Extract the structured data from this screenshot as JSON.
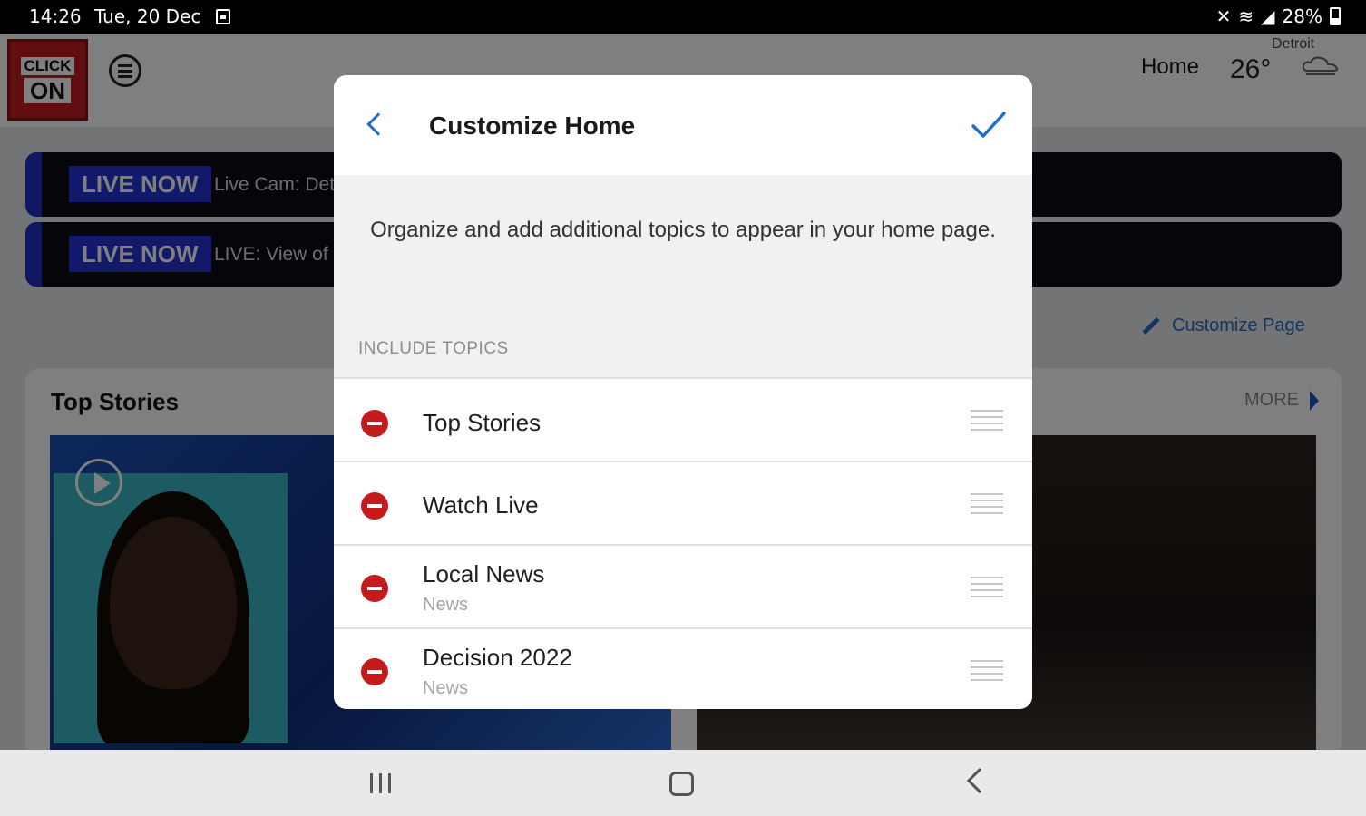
{
  "status_bar": {
    "time": "14:26",
    "date": "Tue, 20 Dec",
    "battery": "28%"
  },
  "header": {
    "logo_line1": "CLICK",
    "logo_line2": "ON",
    "home_label": "Home",
    "city": "Detroit",
    "temperature": "26°"
  },
  "live_banners": [
    {
      "badge": "LIVE NOW",
      "text": "Live Cam: Detro"
    },
    {
      "badge": "LIVE NOW",
      "text": "LIVE: View of D"
    }
  ],
  "customize_page_label": "Customize Page",
  "card": {
    "title": "Top Stories",
    "more_label": "MORE"
  },
  "dialog": {
    "title": "Customize Home",
    "description": "Organize and add additional topics to appear in your home page.",
    "section_label": "INCLUDE TOPICS",
    "topics": [
      {
        "label": "Top Stories",
        "sub": ""
      },
      {
        "label": "Watch Live",
        "sub": ""
      },
      {
        "label": "Local News",
        "sub": "News"
      },
      {
        "label": "Decision 2022",
        "sub": "News"
      }
    ]
  },
  "colors": {
    "accent": "#1e6fd0",
    "remove": "#c41c1c",
    "live_badge": "#2433d6"
  },
  "icons": [
    "back-icon",
    "check-icon",
    "remove-icon",
    "drag-handle-icon",
    "menu-icon",
    "pencil-icon",
    "play-icon",
    "recent-apps-icon",
    "home-nav-icon",
    "back-nav-icon"
  ]
}
